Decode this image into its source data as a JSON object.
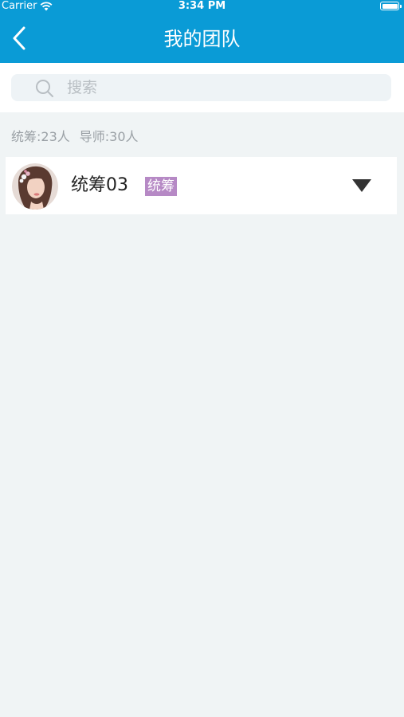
{
  "status_bar": {
    "carrier": "Carrier",
    "time": "3:34 PM"
  },
  "nav": {
    "title": "我的团队",
    "back_icon": "chevron-left-icon"
  },
  "search": {
    "placeholder": "搜索",
    "value": "",
    "icon": "search-icon"
  },
  "summary": {
    "coordinators": "统筹:23人",
    "mentors": "导师:30人"
  },
  "members": [
    {
      "name": "统筹03",
      "role": "统筹",
      "expand_icon": "triangle-down-icon"
    }
  ],
  "colors": {
    "header": "#0a9bd6",
    "background": "#f0f4f5",
    "badge": "#b689c5",
    "summary_text": "#9aa0a5"
  }
}
